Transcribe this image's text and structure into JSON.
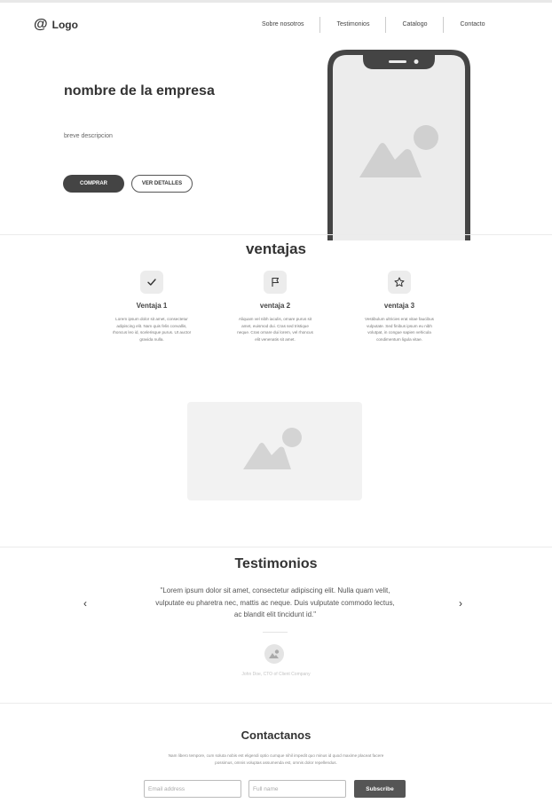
{
  "header": {
    "logo_symbol": "@",
    "logo_text": "Logo",
    "nav": [
      "Sobre nosotros",
      "Testimonios",
      "Catalogo",
      "Contacto"
    ]
  },
  "hero": {
    "title": "nombre de la empresa",
    "description": "breve descripcion",
    "buy_label": "COMPRAR",
    "details_label": "VER DETALLES",
    "phone_image_icon": "image-placeholder-icon"
  },
  "advantages": {
    "title": "ventajas",
    "items": [
      {
        "icon": "check-icon",
        "title": "Ventaja 1",
        "text": "Lorem ipsum dolor sit amet, consectetur adipiscing elit. Nam quis felis convallis, rhoncus leo id, scelerisque purus. Ut auctor gravida nulla."
      },
      {
        "icon": "flag-icon",
        "title": "ventaja 2",
        "text": "Aliquam vel nibh iaculis, ornare purus sit amet, euismod dui. Cras sed tristique neque. Cras ornare dui lorem, vel rhoncus elit venenatis sit amet."
      },
      {
        "icon": "star-icon",
        "title": "ventaja 3",
        "text": "Vestibulum ultricies erat vitae faucibus vulputate. Sed finibus ipsum eu nibh volutpat, in congue sapien vehicula condimentum ligula vitae."
      }
    ]
  },
  "testimonials": {
    "title": "Testimonios",
    "quote": "\"Lorem ipsum dolor sit amet, consectetur adipiscing elit. Nulla quam velit, vulputate eu pharetra nec, mattis ac neque. Duis vulputate commodo lectus, ac blandit elit tincidunt id.\"",
    "prev": "‹",
    "next": "›",
    "author": "John Doe, CTO of Client Company"
  },
  "contact": {
    "title": "Contactanos",
    "description": "Nam libero tempore, cum soluta nobis est eligendi optio cumque nihil impedit quo minus id quod maxime placeat facere possimus, omnis voluptas assumenda est, omnis dolor repellendus.",
    "email_placeholder": "Email address",
    "name_placeholder": "Full name",
    "subscribe_label": "Subscribe"
  }
}
